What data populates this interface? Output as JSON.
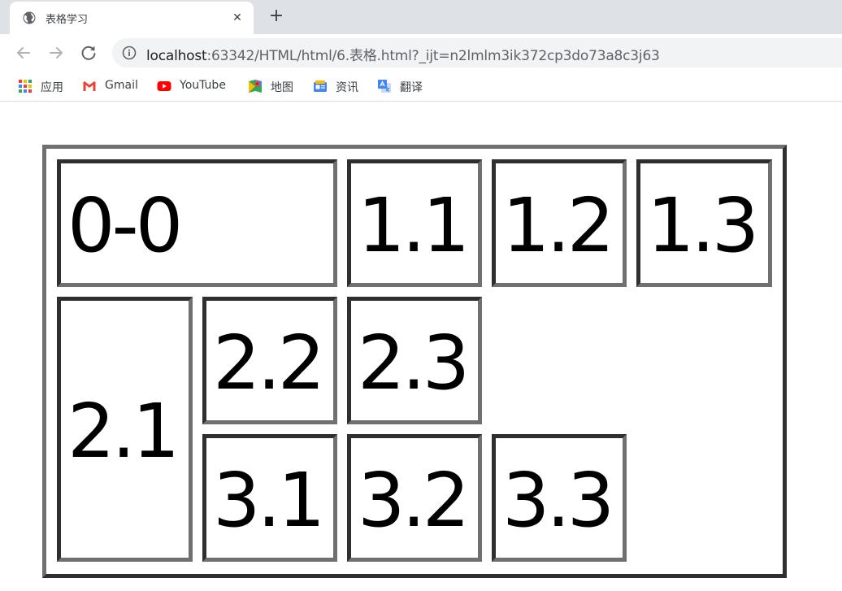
{
  "tab": {
    "title": "表格学习",
    "close_glyph": "✕",
    "new_tab_glyph": "+"
  },
  "toolbar": {
    "url_host": "localhost",
    "url_rest": ":63342/HTML/html/6.表格.html?_ijt=n2lmlm3ik372cp3do73a8c3j63"
  },
  "bookmarks": [
    {
      "label": "应用",
      "icon": "apps-grid-icon"
    },
    {
      "label": "Gmail",
      "icon": "gmail-icon"
    },
    {
      "label": "YouTube",
      "icon": "youtube-icon"
    },
    {
      "label": "地图",
      "icon": "maps-icon"
    },
    {
      "label": "资讯",
      "icon": "news-icon"
    },
    {
      "label": "翻译",
      "icon": "translate-icon"
    }
  ],
  "table": {
    "cells": {
      "r0c0": "0-0",
      "r1c1": "1.1",
      "r1c2": "1.2",
      "r1c3": "1.3",
      "r2c1": "2.1",
      "r2c2": "2.2",
      "r2c3": "2.3",
      "r3c1": "3.1",
      "r3c2": "3.2",
      "r3c3": "3.3"
    }
  },
  "colors": {
    "tabstrip": "#dee1e6",
    "omnibox": "#f1f3f4",
    "border_dark": "#2f2f2f",
    "border_light": "#707070"
  }
}
